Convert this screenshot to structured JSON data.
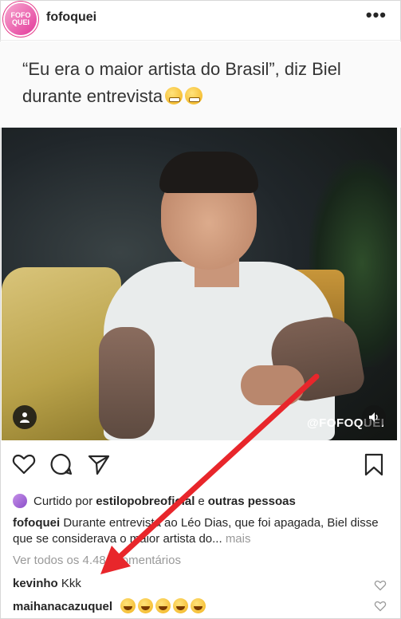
{
  "post": {
    "username": "fofoquei",
    "avatar_text": "FOFO\nQUEI",
    "more_label": "•••"
  },
  "caption_card": {
    "text": "“Eu era o maior artista do Brasil”, diz Biel durante entrevista",
    "emoji_count": 2
  },
  "video": {
    "watermark": "@FOFOQUEI",
    "user_icon": "user-icon",
    "mute_icon": "volume-icon"
  },
  "actions": {
    "like_icon": "heart-icon",
    "comment_icon": "comment-icon",
    "share_icon": "send-icon",
    "save_icon": "bookmark-icon"
  },
  "likes": {
    "prefix": "Curtido por",
    "user": "estilopobreoficial",
    "conjunction": "e",
    "others": "outras pessoas"
  },
  "description": {
    "user": "fofoquei",
    "text": "Durante entrevista ao Léo Dias, que foi apagada, Biel disse que se considerava o maior artista do...",
    "more": "mais"
  },
  "view_all": "Ver todos os 4.484 comentários",
  "comments": [
    {
      "user": "kevinho",
      "text": "Kkk"
    },
    {
      "user": "maihanacazuquel",
      "text": ""
    }
  ],
  "colors": {
    "arrow": "#e8262b",
    "accent": "#e43c8a"
  }
}
